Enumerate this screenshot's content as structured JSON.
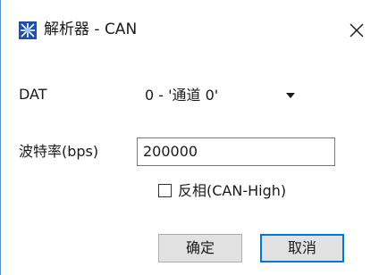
{
  "window": {
    "title": "解析器 - CAN",
    "icon": "analyzer-app-icon",
    "close_icon": "close-icon"
  },
  "form": {
    "channel_label": "DAT",
    "channel_value": "0 - '通道 0'",
    "baudrate_label": "波特率(bps)",
    "baudrate_value": "200000",
    "invert_label": "反相(CAN-High)",
    "invert_checked": false
  },
  "buttons": {
    "ok_label": "确定",
    "cancel_label": "取消"
  },
  "colors": {
    "accent": "#0078d7",
    "button_face": "#e1e1e1",
    "input_border": "#7a7a7a"
  }
}
